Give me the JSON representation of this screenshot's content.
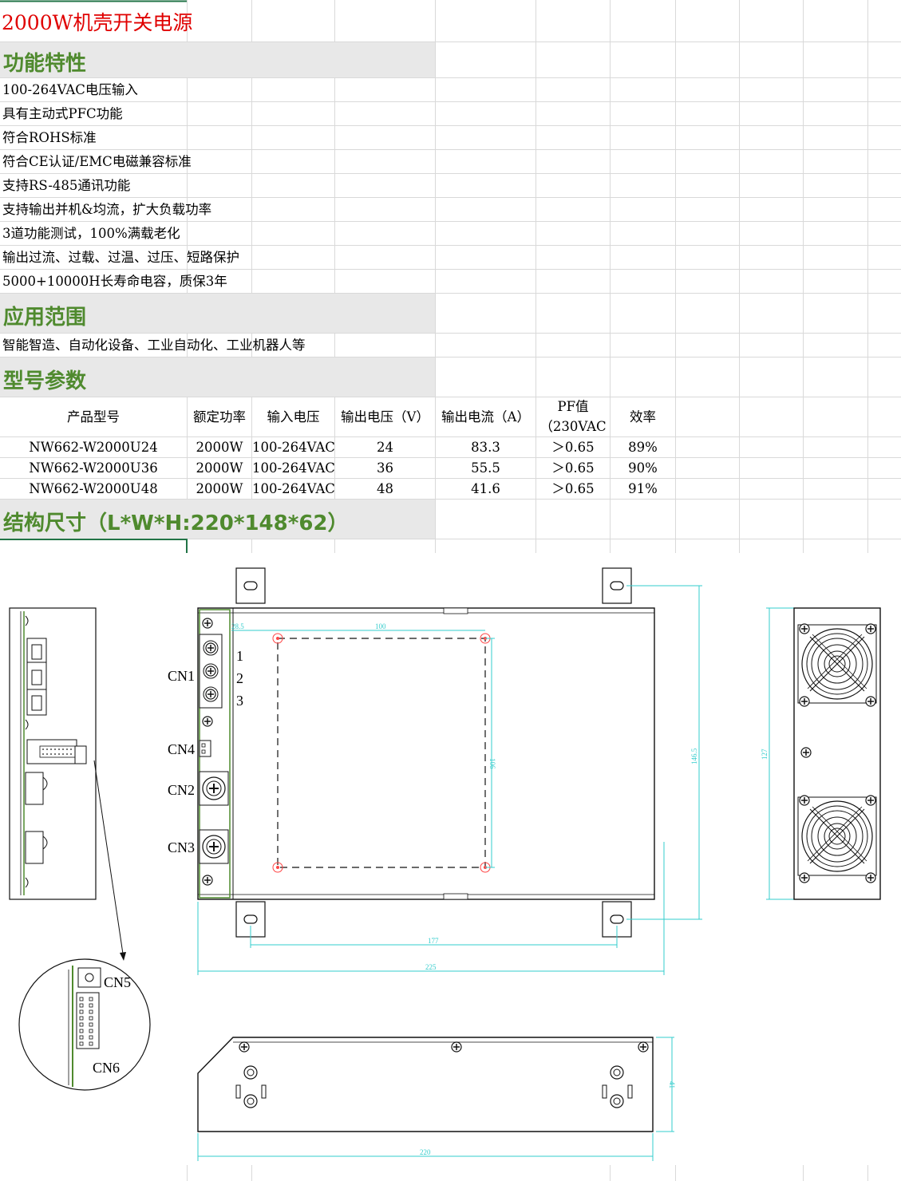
{
  "title": "2000W机壳开关电源",
  "sections": {
    "features": "功能特性",
    "applications": "应用范围",
    "models": "型号参数",
    "dimensions": "结构尺寸（L*W*H:220*148*62）"
  },
  "features": [
    "100-264VAC电压输入",
    "具有主动式PFC功能",
    "符合ROHS标准",
    "符合CE认证/EMC电磁兼容标准",
    "支持RS-485通讯功能",
    "支持输出并机&均流，扩大负载功率",
    "3道功能测试，100%满载老化",
    "输出过流、过载、过温、过压、短路保护",
    "5000+10000H长寿命电容，质保3年"
  ],
  "applications": "智能智造、自动化设备、工业自动化、工业机器人等",
  "table": {
    "headers": [
      "产品型号",
      "额定功率",
      "输入电压",
      "输出电压（V）",
      "输出电流（A）",
      "PF值",
      "（230VAC",
      "效率"
    ],
    "rows": [
      [
        "NW662-W2000U24",
        "2000W",
        "100-264VAC",
        "24",
        "83.3",
        "＞0.65",
        "89%"
      ],
      [
        "NW662-W2000U36",
        "2000W",
        "100-264VAC",
        "36",
        "55.5",
        "＞0.65",
        "90%"
      ],
      [
        "NW662-W2000U48",
        "2000W",
        "100-264VAC",
        "48",
        "41.6",
        "＞0.65",
        "91%"
      ]
    ]
  },
  "drawing": {
    "connectors": [
      "CN1",
      "CN4",
      "CN2",
      "CN3",
      "CN5",
      "CN6"
    ],
    "pins": [
      "1",
      "2",
      "3"
    ],
    "dims": [
      "28.5",
      "100",
      "106",
      "146.5",
      "127",
      "177",
      "225",
      "41",
      "220"
    ],
    "accent_color": "#4f8a2e",
    "dim_color": "#33cccc",
    "marker_color": "#ff4444"
  }
}
